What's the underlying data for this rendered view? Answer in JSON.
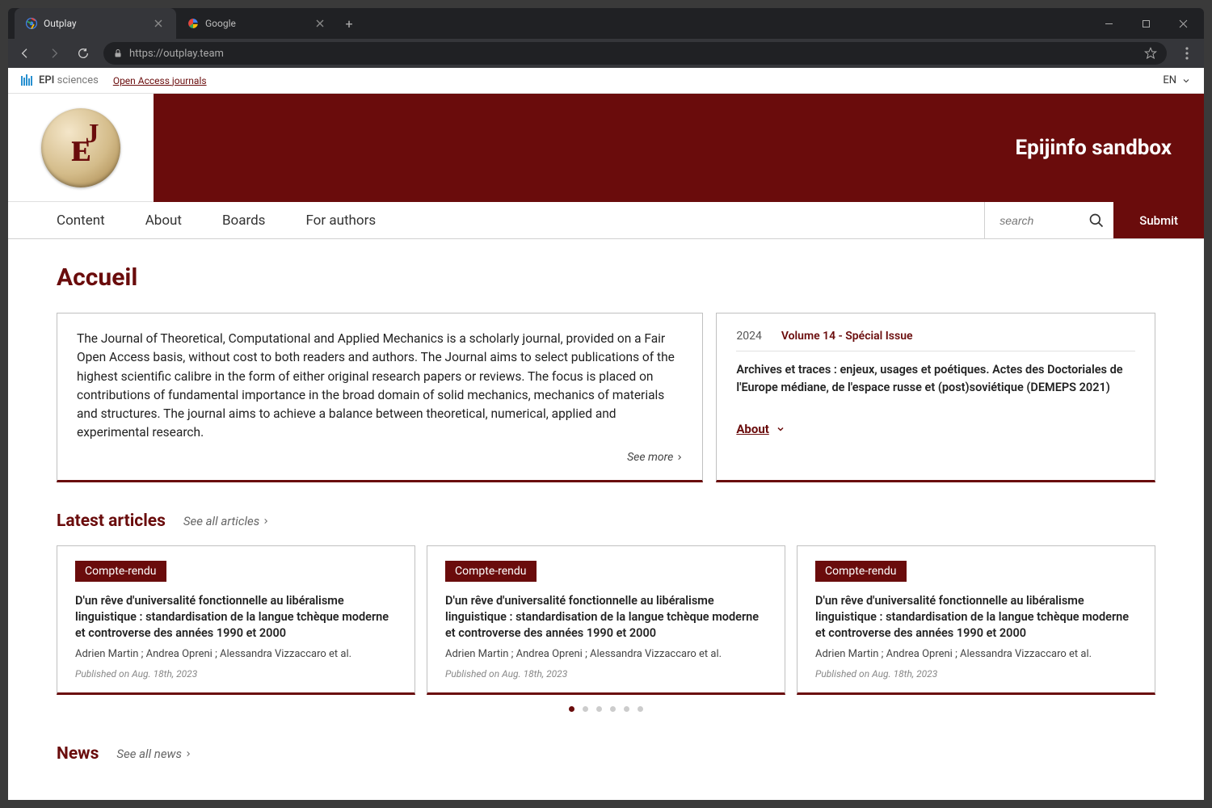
{
  "browser": {
    "tabs": [
      {
        "title": "Outplay",
        "active": true
      },
      {
        "title": "Google",
        "active": false
      }
    ],
    "url": "https://outplay.team"
  },
  "topbar": {
    "logo_text_epi": "EPI",
    "logo_text_sci": " sciences",
    "oa_link": "Open Access journals",
    "lang": "EN"
  },
  "banner": {
    "title": "Epijinfo sandbox"
  },
  "nav": {
    "items": [
      "Content",
      "About",
      "Boards",
      "For authors"
    ],
    "search_placeholder": "search",
    "submit": "Submit"
  },
  "page": {
    "title": "Accueil",
    "description": "The Journal of Theoretical, Computational and Applied Mechanics is a scholarly journal, provided on a Fair Open Access basis, without cost to both readers and authors. The Journal aims to select publications of the highest scientific calibre in the form of either original research papers or reviews. The focus is placed on contributions of fundamental importance in the broad domain of solid mechanics, mechanics of materials and structures. The journal aims to achieve a balance between theoretical, numerical, applied and experimental research.",
    "see_more": "See more",
    "issue": {
      "year": "2024",
      "volume": "Volume 14 - Spécial Issue",
      "title": "Archives et traces : enjeux, usages et poétiques. Actes des Doctoriales de l'Europe médiane, de l'espace russe et (post)soviétique (DEMEPS 2021)",
      "about": "About"
    }
  },
  "latest": {
    "heading": "Latest articles",
    "see_all": "See all articles",
    "cards": [
      {
        "tag": "Compte-rendu",
        "title": "D'un rêve d'universalité fonctionnelle au libéralisme linguistique : standardisation de la langue tchèque moderne et controverse des années 1990 et 2000",
        "authors": "Adrien Martin ; Andrea Opreni ; Alessandra Vizzaccaro et al.",
        "date": "Published on Aug. 18th, 2023"
      },
      {
        "tag": "Compte-rendu",
        "title": "D'un rêve d'universalité fonctionnelle au libéralisme linguistique : standardisation de la langue tchèque moderne et controverse des années 1990 et 2000",
        "authors": "Adrien Martin ; Andrea Opreni ; Alessandra Vizzaccaro et al.",
        "date": "Published on Aug. 18th, 2023"
      },
      {
        "tag": "Compte-rendu",
        "title": "D'un rêve d'universalité fonctionnelle au libéralisme linguistique : standardisation de la langue tchèque moderne et controverse des années 1990 et 2000",
        "authors": "Adrien Martin ; Andrea Opreni ; Alessandra Vizzaccaro et al.",
        "date": "Published on Aug. 18th, 2023"
      }
    ],
    "dot_count": 6,
    "active_dot": 0
  },
  "news": {
    "heading": "News",
    "see_all": "See all news"
  }
}
